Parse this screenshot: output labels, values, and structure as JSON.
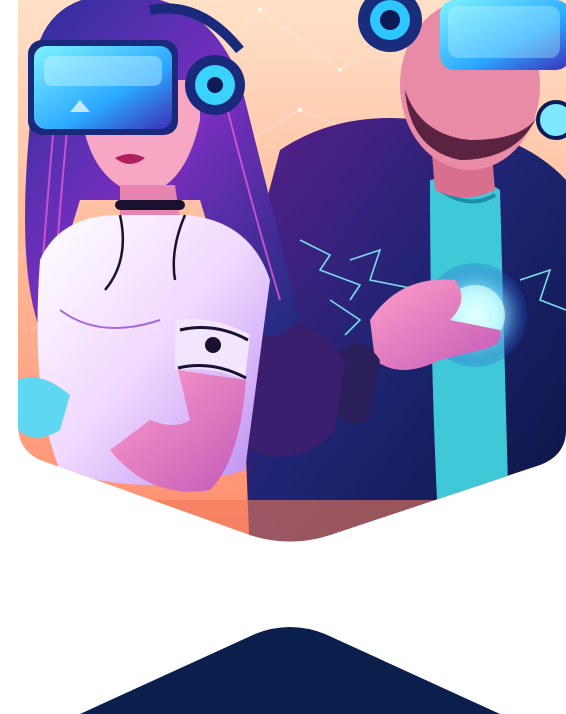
{
  "page": {
    "background": "#ffffff"
  },
  "hero_image": {
    "subject": "two-people-wearing-vr-headsets",
    "palette": {
      "sky_top": "#ffd6b8",
      "sky_bottom": "#ff9a7a",
      "neon_cyan": "#38e8ff",
      "neon_magenta": "#c22bd1",
      "deep_navy": "#0f1e55",
      "violet": "#6b2fb0"
    }
  },
  "bottom_shape": {
    "color": "#0b1f4d"
  }
}
